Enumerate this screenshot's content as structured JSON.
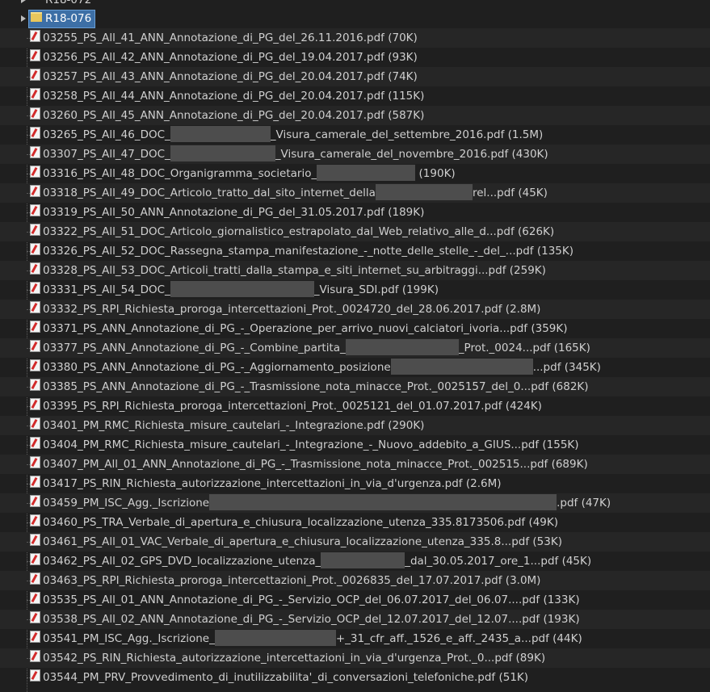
{
  "tree": {
    "prev_folder": "R18-072",
    "folder": "R18-076",
    "files": [
      {
        "name": "03255_PS_All_41_ANN_Annotazione_di_PG_del_26.11.2016.pdf",
        "size": "(70K)"
      },
      {
        "name": "03256_PS_All_42_ANN_Annotazione_di_PG_del_19.04.2017.pdf",
        "size": "(93K)"
      },
      {
        "name": "03257_PS_All_43_ANN_Annotazione_di_PG_del_20.04.2017.pdf",
        "size": "(74K)"
      },
      {
        "name": "03258_PS_All_44_ANN_Annotazione_di_PG_del_20.04.2017.pdf",
        "size": "(115K)"
      },
      {
        "name": "03260_PS_All_45_ANN_Annotazione_di_PG_del_20.04.2017.pdf",
        "size": "(587K)"
      },
      {
        "name": "03265_PS_All_46_DOC_",
        "name2": "_Visura_camerale_del_settembre_2016.pdf",
        "size": "(1.5M)"
      },
      {
        "name": "03307_PS_All_47_DOC_",
        "name2": "_Visura_camerale_del_novembre_2016.pdf",
        "size": "(430K)"
      },
      {
        "name": "03316_PS_All_48_DOC_Organigramma_societario_",
        "name2": "",
        "size": "(190K)"
      },
      {
        "name": "03318_PS_All_49_DOC_Articolo_tratto_dal_sito_internet_della",
        "name2": "rel...pdf",
        "size": "(45K)"
      },
      {
        "name": "03319_PS_All_50_ANN_Annotazione_di_PG_del_31.05.2017.pdf",
        "size": "(189K)"
      },
      {
        "name": "03322_PS_All_51_DOC_Articolo_giornalistico_estrapolato_dal_Web_relativo_alle_d...pdf",
        "size": "(626K)"
      },
      {
        "name": "03326_PS_All_52_DOC_Rassegna_stampa_manifestazione_-_notte_delle_stelle_-_del_...pdf",
        "size": "(135K)"
      },
      {
        "name": "03328_PS_All_53_DOC_Articoli_tratti_dalla_stampa_e_siti_internet_su_arbitraggi...pdf",
        "size": "(259K)"
      },
      {
        "name": "03331_PS_All_54_DOC_",
        "name2": "_Visura_SDI.pdf",
        "size": "(199K)"
      },
      {
        "name": "03332_PS_RPI_Richiesta_proroga_intercettazioni_Prot._0024720_del_28.06.2017.pdf",
        "size": "(2.8M)"
      },
      {
        "name": "03371_PS_ANN_Annotazione_di_PG_-_Operazione_per_arrivo_nuovi_calciatori_ivoria...pdf",
        "size": "(359K)"
      },
      {
        "name": "03377_PS_ANN_Annotazione_di_PG_-_Combine_partita_",
        "name2": "_Prot._0024...pdf",
        "size": "(165K)"
      },
      {
        "name": "03380_PS_ANN_Annotazione_di_PG_-_Aggiornamento_posizione",
        "name2": "...pdf",
        "size": "(345K)"
      },
      {
        "name": "03385_PS_ANN_Annotazione_di_PG_-_Trasmissione_nota_minacce_Prot._0025157_del_0...pdf",
        "size": "(682K)"
      },
      {
        "name": "03395_PS_RPI_Richiesta_proroga_intercettazioni_Prot._0025121_del_01.07.2017.pdf",
        "size": "(424K)"
      },
      {
        "name": "03401_PM_RMC_Richiesta_misure_cautelari_-_Integrazione.pdf",
        "size": "(290K)"
      },
      {
        "name": "03404_PM_RMC_Richiesta_misure_cautelari_-_Integrazione_-_Nuovo_addebito_a_GIUS...pdf",
        "size": "(155K)"
      },
      {
        "name": "03407_PM_All_01_ANN_Annotazione_di_PG_-_Trasmissione_nota_minacce_Prot._002515...pdf",
        "size": "(689K)"
      },
      {
        "name": "03417_PS_RIN_Richiesta_autorizzazione_intercettazioni_in_via_d'urgenza.pdf",
        "size": "(2.6M)"
      },
      {
        "name": "03459_PM_ISC_Agg._Iscrizione",
        "name2": ".pdf",
        "size": "(47K)"
      },
      {
        "name": "03460_PS_TRA_Verbale_di_apertura_e_chiusura_localizzazione_utenza_335.8173506.pdf",
        "size": "(49K)"
      },
      {
        "name": "03461_PS_All_01_VAC_Verbale_di_apertura_e_chiusura_localizzazione_utenza_335.8...pdf",
        "size": "(53K)"
      },
      {
        "name": "03462_PS_All_02_GPS_DVD_localizzazione_utenza_",
        "name2": "_dal_30.05.2017_ore_1...pdf",
        "size": "(45K)"
      },
      {
        "name": "03463_PS_RPI_Richiesta_proroga_intercettazioni_Prot._0026835_del_17.07.2017.pdf",
        "size": "(3.0M)"
      },
      {
        "name": "03535_PS_All_01_ANN_Annotazione_di_PG_-_Servizio_OCP_del_06.07.2017_del_06.07....pdf",
        "size": "(133K)"
      },
      {
        "name": "03538_PS_All_02_ANN_Annotazione_di_PG_-_Servizio_OCP_del_12.07.2017_del_12.07....pdf",
        "size": "(193K)"
      },
      {
        "name": "03541_PM_ISC_Agg._Iscrizione_",
        "name2": "+_31_cfr_aff._1526_e_aff._2435_a...pdf",
        "size": "(44K)"
      },
      {
        "name": "03542_PS_RIN_Richiesta_autorizzazione_intercettazioni_in_via_d'urgenza_Prot._0...pdf",
        "size": "(89K)"
      },
      {
        "name": "03544_PM_PRV_Provvedimento_di_inutilizzabilita'_di_conversazioni_telefoniche.pdf",
        "size": "(51K)"
      }
    ]
  }
}
